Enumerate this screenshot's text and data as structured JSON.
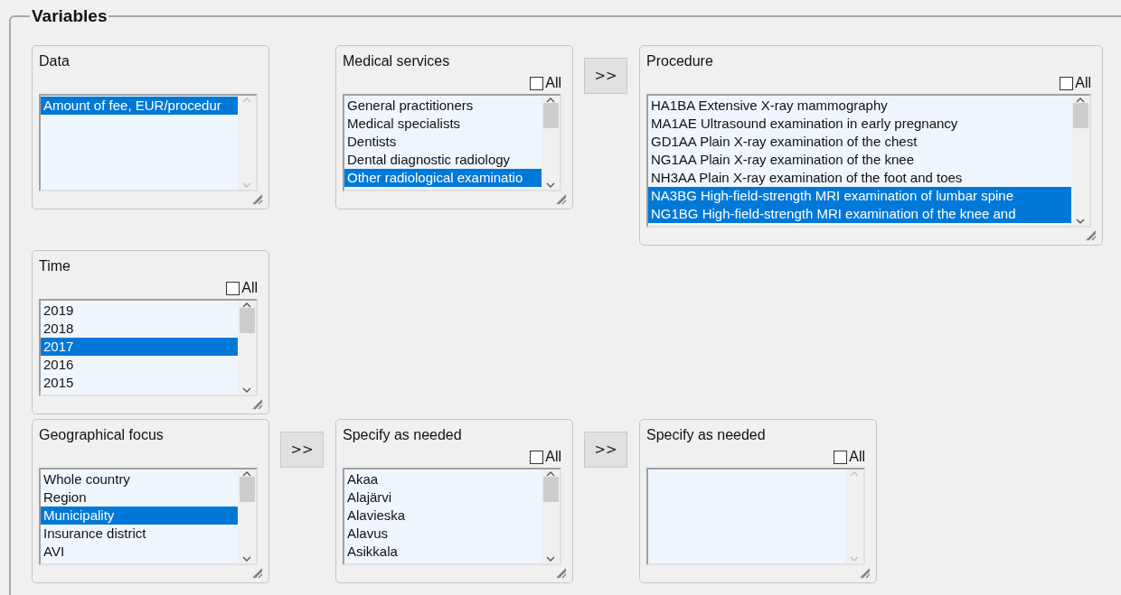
{
  "fieldset": {
    "legend": "Variables"
  },
  "rows": [
    {
      "panels": [
        {
          "title": "Data",
          "kind": "standard",
          "items": [
            {
              "label": "Amount of fee, EUR/procedur",
              "selected": true
            }
          ]
        },
        {
          "title": "Medical services",
          "kind": "standard",
          "all_option": {
            "label": "All",
            "checked": false
          },
          "next_button": ">>",
          "items": [
            {
              "label": "General practitioners",
              "selected": false
            },
            {
              "label": "Medical specialists",
              "selected": false
            },
            {
              "label": "Dentists",
              "selected": false
            },
            {
              "label": "Dental diagnostic radiology",
              "selected": false
            },
            {
              "label": "Other radiological examinatio",
              "selected": true
            }
          ]
        },
        {
          "title": "Procedure",
          "kind": "wide",
          "all_option": {
            "label": "All",
            "checked": false
          },
          "items": [
            {
              "label": "HA1BA Extensive X-ray mammography",
              "selected": false
            },
            {
              "label": "MA1AE Ultrasound examination in early pregnancy",
              "selected": false
            },
            {
              "label": "GD1AA Plain X-ray examination of the chest",
              "selected": false
            },
            {
              "label": "NG1AA Plain X-ray examination of the knee",
              "selected": false
            },
            {
              "label": "NH3AA Plain X-ray examination of the foot and toes",
              "selected": false
            },
            {
              "label": "NA3BG High-field-strength MRI examination of lumbar spine",
              "selected": true
            },
            {
              "label": "NG1BG High-field-strength MRI examination of the knee and",
              "selected": true
            }
          ]
        }
      ]
    },
    {
      "panels": [
        {
          "title": "Time",
          "kind": "standard",
          "all_option": {
            "label": "All",
            "checked": false
          },
          "items": [
            {
              "label": "2019",
              "selected": false
            },
            {
              "label": "2018",
              "selected": false
            },
            {
              "label": "2017",
              "selected": true
            },
            {
              "label": "2016",
              "selected": false
            },
            {
              "label": "2015",
              "selected": false
            }
          ]
        }
      ]
    },
    {
      "panels": [
        {
          "title": "Geographical focus",
          "kind": "standard",
          "next_button": ">>",
          "items": [
            {
              "label": "Whole country",
              "selected": false
            },
            {
              "label": "Region",
              "selected": false
            },
            {
              "label": "Municipality",
              "selected": true
            },
            {
              "label": "Insurance district",
              "selected": false
            },
            {
              "label": "AVI",
              "selected": false
            }
          ]
        },
        {
          "title": "Specify as needed",
          "kind": "standard",
          "all_option": {
            "label": "All",
            "checked": false
          },
          "next_button": ">>",
          "items": [
            {
              "label": "Akaa",
              "selected": false
            },
            {
              "label": "Alajärvi",
              "selected": false
            },
            {
              "label": "Alavieska",
              "selected": false
            },
            {
              "label": "Alavus",
              "selected": false
            },
            {
              "label": "Asikkala",
              "selected": false
            }
          ]
        },
        {
          "title": "Specify as needed",
          "kind": "standard",
          "all_option": {
            "label": "All",
            "checked": false
          }
        }
      ]
    }
  ]
}
